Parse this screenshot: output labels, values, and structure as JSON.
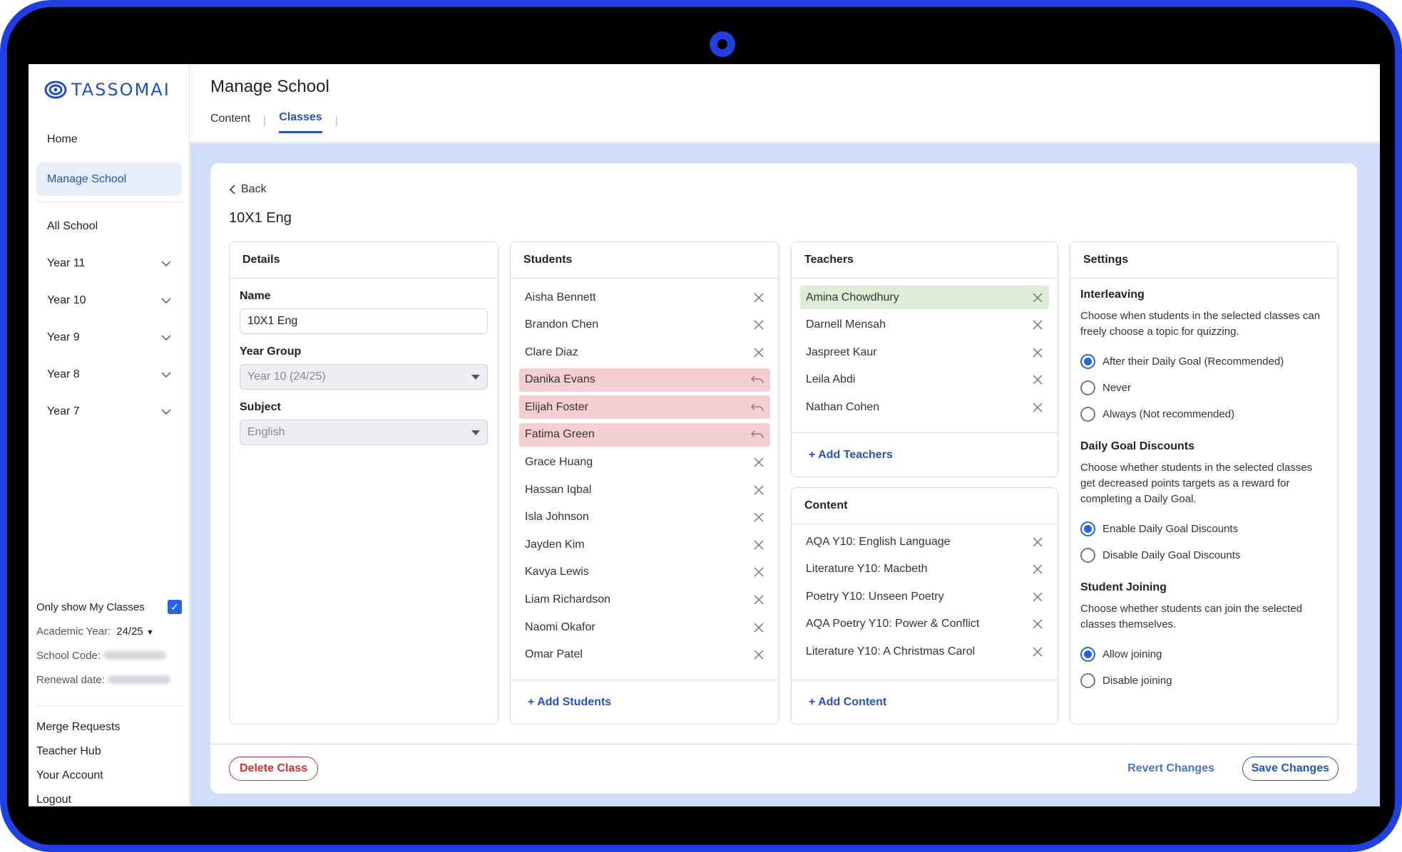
{
  "app": {
    "logo_text": "TASSOMAI"
  },
  "sidebar": {
    "nav": [
      {
        "label": "Home"
      },
      {
        "label": "Manage School"
      }
    ],
    "groups": [
      {
        "label": "All School"
      },
      {
        "label": "Year 11"
      },
      {
        "label": "Year 10"
      },
      {
        "label": "Year 9"
      },
      {
        "label": "Year 8"
      },
      {
        "label": "Year 7"
      }
    ],
    "only_my_classes_label": "Only show My Classes",
    "academic_year_label": "Academic Year:",
    "academic_year_value": "24/25",
    "school_code_label": "School Code:",
    "renewal_date_label": "Renewal date:",
    "links": [
      {
        "label": "Merge Requests"
      },
      {
        "label": "Teacher Hub"
      },
      {
        "label": "Your Account"
      },
      {
        "label": "Logout"
      }
    ]
  },
  "header": {
    "title": "Manage School",
    "tabs": [
      {
        "label": "Content"
      },
      {
        "label": "Classes"
      }
    ]
  },
  "class_page": {
    "back_label": "Back",
    "class_title": "10X1 Eng",
    "details": {
      "title": "Details",
      "name_label": "Name",
      "name_value": "10X1 Eng",
      "year_group_label": "Year Group",
      "year_group_value": "Year 10 (24/25)",
      "subject_label": "Subject",
      "subject_value": "English"
    },
    "students": {
      "title": "Students",
      "items": [
        {
          "name": "Aisha Bennett",
          "state": "normal"
        },
        {
          "name": "Brandon Chen",
          "state": "normal"
        },
        {
          "name": "Clare Diaz",
          "state": "normal"
        },
        {
          "name": "Danika Evans",
          "state": "removed"
        },
        {
          "name": "Elijah Foster",
          "state": "removed"
        },
        {
          "name": "Fatima Green",
          "state": "removed"
        },
        {
          "name": "Grace Huang",
          "state": "normal"
        },
        {
          "name": "Hassan Iqbal",
          "state": "normal"
        },
        {
          "name": "Isla Johnson",
          "state": "normal"
        },
        {
          "name": "Jayden Kim",
          "state": "normal"
        },
        {
          "name": "Kavya Lewis",
          "state": "normal"
        },
        {
          "name": "Liam Richardson",
          "state": "normal"
        },
        {
          "name": "Naomi Okafor",
          "state": "normal"
        },
        {
          "name": "Omar Patel",
          "state": "normal"
        }
      ],
      "add_label": "+ Add Students"
    },
    "teachers": {
      "title": "Teachers",
      "items": [
        {
          "name": "Amina Chowdhury",
          "state": "added"
        },
        {
          "name": "Darnell Mensah",
          "state": "normal"
        },
        {
          "name": "Jaspreet Kaur",
          "state": "normal"
        },
        {
          "name": "Leila Abdi",
          "state": "normal"
        },
        {
          "name": "Nathan Cohen",
          "state": "normal"
        }
      ],
      "add_label": "+ Add Teachers"
    },
    "content": {
      "title": "Content",
      "items": [
        {
          "name": "AQA Y10: English Language"
        },
        {
          "name": "Literature Y10: Macbeth"
        },
        {
          "name": "Poetry Y10: Unseen Poetry"
        },
        {
          "name": "AQA Poetry Y10: Power & Conflict"
        },
        {
          "name": "Literature Y10: A Christmas Carol"
        }
      ],
      "add_label": "+ Add Content"
    },
    "settings": {
      "title": "Settings",
      "interleaving": {
        "heading": "Interleaving",
        "description": "Choose when students in the selected classes can freely choose a topic for quizzing.",
        "options": [
          {
            "label": "After their Daily Goal (Recommended)",
            "selected": true
          },
          {
            "label": "Never",
            "selected": false
          },
          {
            "label": "Always (Not recommended)",
            "selected": false
          }
        ]
      },
      "discounts": {
        "heading": "Daily Goal Discounts",
        "description": "Choose whether students in the selected classes get decreased points targets as a reward for completing a Daily Goal.",
        "options": [
          {
            "label": "Enable Daily Goal Discounts",
            "selected": true
          },
          {
            "label": "Disable Daily Goal Discounts",
            "selected": false
          }
        ]
      },
      "joining": {
        "heading": "Student Joining",
        "description": "Choose whether students can join the selected classes themselves.",
        "options": [
          {
            "label": "Allow joining",
            "selected": true
          },
          {
            "label": "Disable joining",
            "selected": false
          }
        ]
      }
    },
    "footer": {
      "delete_label": "Delete Class",
      "revert_label": "Revert Changes",
      "save_label": "Save Changes"
    }
  },
  "colors": {
    "accent": "#2553b8",
    "removed_row": "#f5cfd1",
    "added_row": "#dcefd6",
    "danger": "#d12f2f",
    "bezel": "#1f3fe0"
  }
}
